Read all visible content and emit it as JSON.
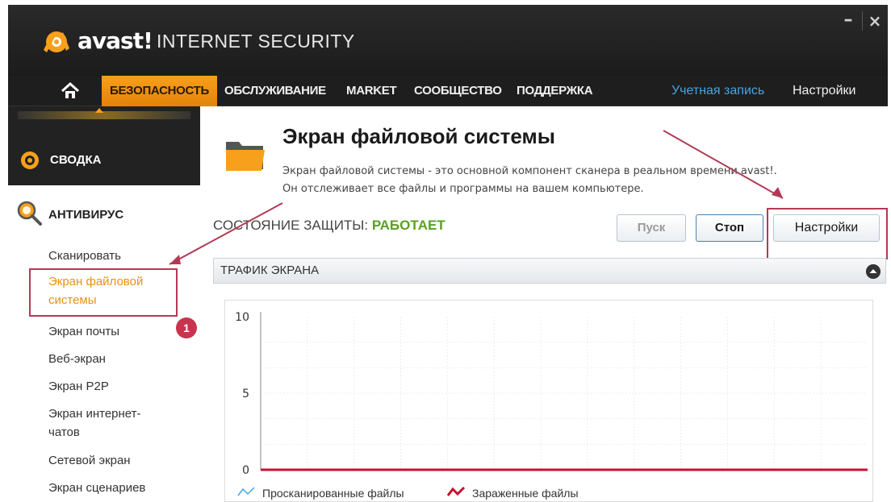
{
  "app": {
    "logo_text": "avast!",
    "product_name": "INTERNET SECURITY",
    "window_controls": {
      "minimize": "–",
      "close": "×"
    }
  },
  "nav": {
    "home_icon": "home-icon",
    "items": [
      {
        "label": "БЕЗОПАСНОСТЬ",
        "active": true
      },
      {
        "label": "ОБСЛУЖИВАНИЕ",
        "active": false
      },
      {
        "label": "MARKET",
        "active": false
      },
      {
        "label": "СООБЩЕСТВО",
        "active": false
      },
      {
        "label": "ПОДДЕРЖКА",
        "active": false
      }
    ],
    "account": "Учетная запись",
    "settings": "Настройки"
  },
  "sidebar": {
    "summary": "СВОДКА",
    "antivirus": "АНТИВИРУС",
    "sub_items": [
      {
        "label": "Сканировать",
        "active": false
      },
      {
        "label": "Экран файловой системы",
        "active": true
      },
      {
        "label": "Экран почты",
        "active": false
      },
      {
        "label": "Веб-экран",
        "active": false
      },
      {
        "label": "Экран P2P",
        "active": false
      },
      {
        "label": "Экран интернет-чатов",
        "active": false
      },
      {
        "label": "Сетевой экран",
        "active": false
      },
      {
        "label": "Экран сценариев",
        "active": false
      }
    ]
  },
  "annotations": {
    "badge_1": "1"
  },
  "main": {
    "title": "Экран файловой системы",
    "description_line1": "Экран файловой системы - это основной компонент сканера в реальном времени avast!.",
    "description_line2": "Он отслеживает все файлы и программы на вашем компьютере.",
    "status_label": "СОСТОЯНИЕ ЗАЩИТЫ:",
    "status_value": "РАБОТАЕТ",
    "buttons": {
      "start": "Пуск",
      "stop": "Стоп",
      "settings": "Настройки"
    },
    "traffic_title": "ТРАФИК ЭКРАНА"
  },
  "colors": {
    "accent_orange": "#f7a01c",
    "status_green": "#5aa020",
    "annotation": "#b23a55",
    "infected_series": "#c8102e",
    "scanned_series": "#4aa3df"
  },
  "chart_data": {
    "type": "line",
    "ylim": [
      0,
      10
    ],
    "yticks": [
      "10",
      "5",
      "0"
    ],
    "series": [
      {
        "name": "Просканированные файлы",
        "values": [
          0,
          0,
          0,
          0,
          0,
          0,
          0,
          0,
          0,
          0,
          0,
          0,
          0
        ]
      },
      {
        "name": "Зараженные файлы",
        "values": [
          0,
          0,
          0,
          0,
          0,
          0,
          0,
          0,
          0,
          0,
          0,
          0,
          0
        ]
      }
    ],
    "grid": true,
    "legend": "bottom"
  }
}
